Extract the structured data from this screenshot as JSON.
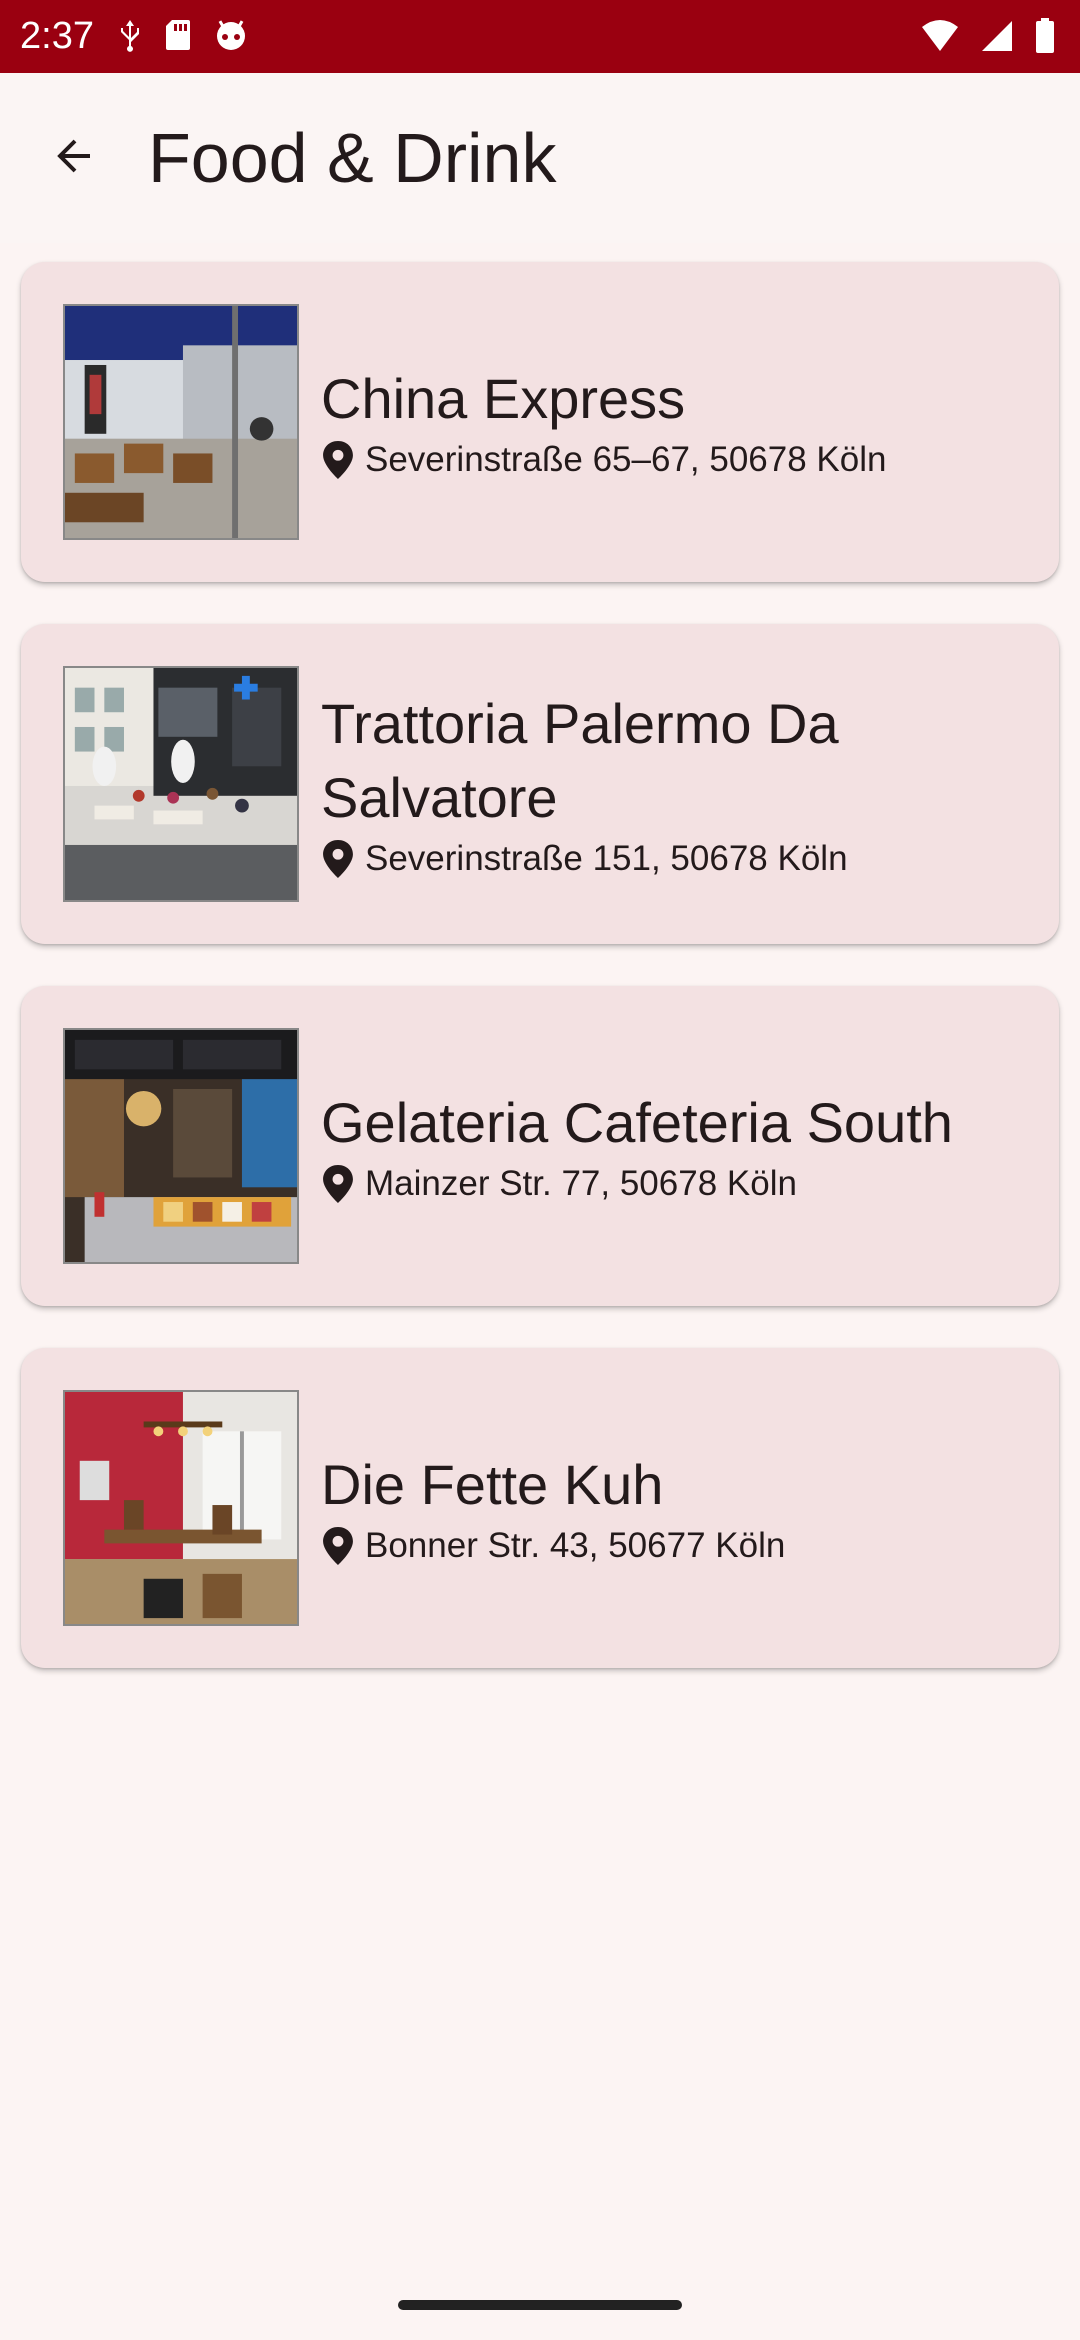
{
  "status_bar": {
    "time": "2:37",
    "left_icons": [
      "usb-debug-icon",
      "sd-card-icon",
      "android-icon"
    ],
    "right_icons": [
      "wifi-icon",
      "cell-signal-icon",
      "battery-icon"
    ],
    "background": "#9a0010"
  },
  "app_bar": {
    "title": "Food & Drink",
    "back_icon": "arrow-back-icon"
  },
  "places": [
    {
      "name": "China Express",
      "address": "Severinstraße 65–67, 50678 Köln",
      "pin_icon": "location-pin-icon",
      "image": "china-express-photo"
    },
    {
      "name": "Trattoria Palermo Da Salvatore",
      "address": "Severinstraße 151, 50678 Köln",
      "pin_icon": "location-pin-icon",
      "image": "trattoria-palermo-photo"
    },
    {
      "name": "Gelateria Cafeteria South",
      "address": "Mainzer Str. 77, 50678 Köln",
      "pin_icon": "location-pin-icon",
      "image": "gelateria-photo"
    },
    {
      "name": "Die Fette Kuh",
      "address": "Bonner Str. 43, 50677 Köln",
      "pin_icon": "location-pin-icon",
      "image": "die-fette-kuh-photo"
    }
  ],
  "colors": {
    "card_background": "#f3e1e2",
    "page_background": "#fcf4f3",
    "text": "#231a1b"
  }
}
